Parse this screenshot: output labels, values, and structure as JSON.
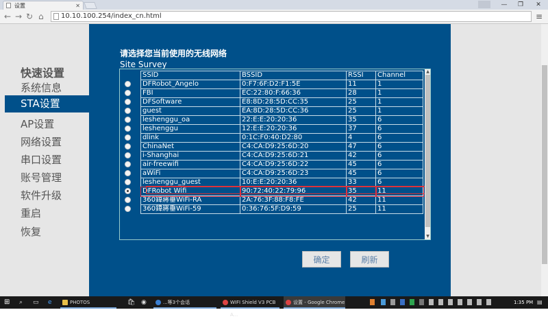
{
  "browser": {
    "tab_title": "设置",
    "url": "10.10.100.254/index_cn.html"
  },
  "sidebar": {
    "title": "快速设置",
    "items": [
      "系统信息",
      "STA设置",
      "AP设置",
      "网络设置",
      "串口设置",
      "账号管理",
      "软件升级",
      "重启",
      "恢复"
    ],
    "active_index": 1
  },
  "main": {
    "heading": "请选择您当前使用的无线网络",
    "survey_label": "Site Survey",
    "columns": [
      "SSID",
      "BSSID",
      "RSSI",
      "Channel"
    ],
    "rows": [
      {
        "ssid": "DFRobot_Angelo",
        "bssid": "0:F7:6F:D2:F1:5E",
        "rssi": "11",
        "channel": "1"
      },
      {
        "ssid": "FBI",
        "bssid": "EC:22:80:F:66:36",
        "rssi": "28",
        "channel": "1"
      },
      {
        "ssid": "DFSoftware",
        "bssid": "E8:8D:28:5D:CC:35",
        "rssi": "25",
        "channel": "1"
      },
      {
        "ssid": "guest",
        "bssid": "EA:8D:28:5D:CC:36",
        "rssi": "25",
        "channel": "1"
      },
      {
        "ssid": "leshenggu_oa",
        "bssid": "22:E:E:20:20:36",
        "rssi": "35",
        "channel": "6"
      },
      {
        "ssid": "leshenggu",
        "bssid": "12:E:E:20:20:36",
        "rssi": "37",
        "channel": "6"
      },
      {
        "ssid": "dlink",
        "bssid": "0:1C:F0:40:D2:80",
        "rssi": "4",
        "channel": "6"
      },
      {
        "ssid": "ChinaNet",
        "bssid": "C4:CA:D9:25:6D:20",
        "rssi": "47",
        "channel": "6"
      },
      {
        "ssid": "i-Shanghai",
        "bssid": "C4:CA:D9:25:6D:21",
        "rssi": "42",
        "channel": "6"
      },
      {
        "ssid": "air-freewifi",
        "bssid": "C4:CA:D9:25:6D:22",
        "rssi": "45",
        "channel": "6"
      },
      {
        "ssid": "aWiFi",
        "bssid": "C4:CA:D9:25:6D:23",
        "rssi": "45",
        "channel": "6"
      },
      {
        "ssid": "leshenggu_guest",
        "bssid": "10:E:E:20:20:36",
        "rssi": "33",
        "channel": "6"
      },
      {
        "ssid": "DFRobot Wifi",
        "bssid": "90:72:40:22:79:96",
        "rssi": "35",
        "channel": "11"
      },
      {
        "ssid": "360鍏嶈垂WiFi-RA",
        "bssid": "2A:76:3F:88:F8:FE",
        "rssi": "42",
        "channel": "11"
      },
      {
        "ssid": "360鍏嶈垂WiFi-59",
        "bssid": "0:36:76:5F:D9:59",
        "rssi": "25",
        "channel": "11"
      }
    ],
    "selected_index": 12,
    "confirm_label": "确定",
    "refresh_label": "刷新"
  },
  "taskbar": {
    "tasks": [
      "PHOTOS",
      "...等3个会话",
      "WIFI Shield V3 PCB A...",
      "设置 - Google Chrome"
    ],
    "clock": "1:35 PM"
  },
  "colors": {
    "primary": "#00508a",
    "selection": "#d33333"
  }
}
